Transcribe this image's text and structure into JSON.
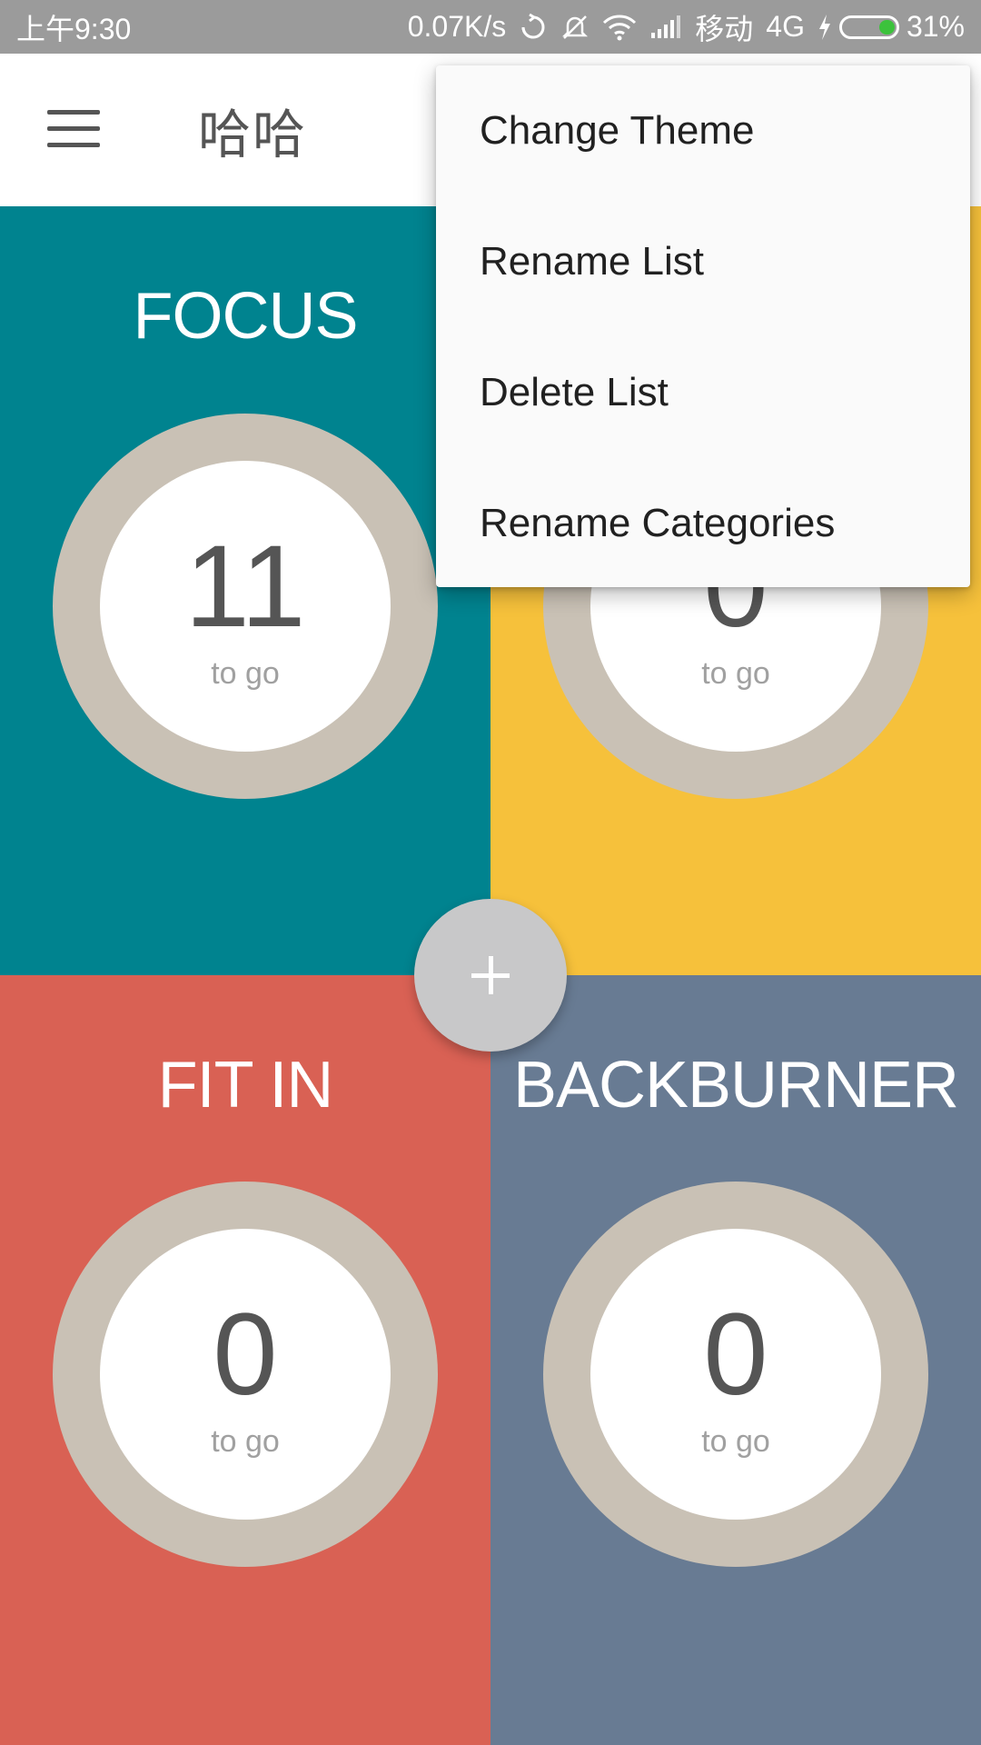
{
  "status_bar": {
    "time": "上午9:30",
    "network_speed": "0.07K/s",
    "carrier": "移动",
    "network_type": "4G",
    "battery_percent": "31%",
    "battery_level": 0.31,
    "battery_color": "#3cc23c",
    "icons": [
      "sync-icon",
      "mute-icon",
      "wifi-icon",
      "signal-icon",
      "charging-icon",
      "battery-icon"
    ]
  },
  "app_bar": {
    "title": "哈哈",
    "menu_icon": "hamburger-menu-icon"
  },
  "quadrants": [
    {
      "name": "FOCUS",
      "count": "11",
      "caption": "to go",
      "color": "#00838f"
    },
    {
      "name": "",
      "count": "0",
      "caption": "to go",
      "color": "#f6c13b"
    },
    {
      "name": "FIT IN",
      "count": "0",
      "caption": "to go",
      "color": "#d96154"
    },
    {
      "name": "BACKBURNER",
      "count": "0",
      "caption": "to go",
      "color": "#687b93"
    }
  ],
  "ring_color": "#c9c1b5",
  "fab": {
    "label": "+",
    "icon": "plus-icon",
    "color": "#c8c8c9"
  },
  "overflow_menu": {
    "items": [
      {
        "label": "Change Theme"
      },
      {
        "label": "Rename List"
      },
      {
        "label": "Delete List"
      },
      {
        "label": "Rename Categories"
      }
    ]
  }
}
